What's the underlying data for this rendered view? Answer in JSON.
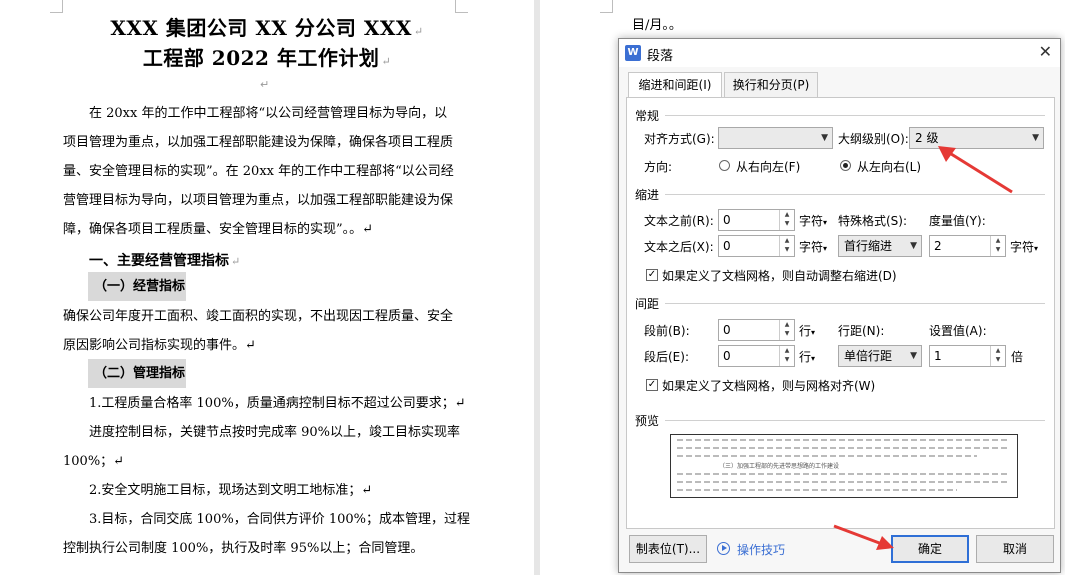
{
  "document": {
    "title_line1": "XXX 集团公司 XX 分公司 XXX",
    "title_line2": "工程部 2022 年工作计划",
    "para_mark": "↵",
    "intro_lines": [
      "在 20xx 年的工作中工程部将“以公司经营管理目标为导向，以",
      "项目管理为重点，以加强工程部职能建设为保障，确保各项目工程质",
      "量、安全管理目标的实现”。在 20xx 年的工作中工程部将“以公司经",
      "营管理目标为导向，以项目管理为重点，以加强工程部职能建设为保",
      "障，确保各项目工程质量、安全管理目标的实现”。。↵"
    ],
    "heading1": "一、主要经营管理指标",
    "heading1_1": "（一）经营指标",
    "para2_lines": [
      "确保公司年度开工面积、竣工面积的实现，不出现因工程质量、安全",
      "原因影响公司指标实现的事件。↵"
    ],
    "heading1_2": "（二）管理指标",
    "list_lines": [
      "1.工程质量合格率 100%，质量通病控制目标不超过公司要求；↵",
      "进度控制目标，关键节点按时完成率 90%以上，竣工目标实现率",
      "100%；↵",
      "2.安全文明施工目标，现场达到文明工地标准；↵",
      "3.目标，合同交底 100%，合同供方评价 100%；成本管理，过程",
      "控制执行公司制度 100%，执行及时率 95%以上；合同管理。"
    ],
    "right_page_text": "目/月。。"
  },
  "dialog": {
    "app_icon": "W",
    "title": "段落",
    "close_icon": "✕",
    "tabs": [
      "缩进和间距(I)",
      "换行和分页(P)"
    ],
    "general": {
      "section": "常规",
      "alignment_label": "对齐方式(G):",
      "alignment_value": "",
      "outline_label": "大纲级别(O):",
      "outline_value": "2 级",
      "direction_label": "方向:",
      "rtl_label": "从右向左(F)",
      "ltr_label": "从左向右(L)",
      "direction_selected": "ltr"
    },
    "indent": {
      "section": "缩进",
      "before_label": "文本之前(R):",
      "before_value": "0",
      "before_unit": "字符",
      "after_label": "文本之后(X):",
      "after_value": "0",
      "after_unit": "字符",
      "special_label": "特殊格式(S):",
      "special_value": "首行缩进",
      "measure_label": "度量值(Y):",
      "measure_value": "2",
      "measure_unit": "字符",
      "grid_check_label": "如果定义了文档网格，则自动调整右缩进(D)",
      "grid_checked": true
    },
    "spacing": {
      "section": "间距",
      "before_label": "段前(B):",
      "before_value": "0",
      "before_unit": "行",
      "after_label": "段后(E):",
      "after_value": "0",
      "after_unit": "行",
      "line_label": "行距(N):",
      "line_value": "单倍行距",
      "setting_label": "设置值(A):",
      "setting_value": "1",
      "setting_unit": "倍",
      "grid_check_label": "如果定义了文档网格，则与网格对齐(W)",
      "grid_checked": true
    },
    "preview": {
      "section": "预览",
      "sample_text": "（三）加强工程部的先进带思想路的工作建设"
    },
    "buttons": {
      "tabs_button": "制表位(T)...",
      "tips": "操作技巧",
      "ok": "确定",
      "cancel": "取消"
    }
  },
  "colors": {
    "accent": "#2f6fd6",
    "annotation_arrow": "#e53935",
    "highlight": "#d9d9d9"
  }
}
